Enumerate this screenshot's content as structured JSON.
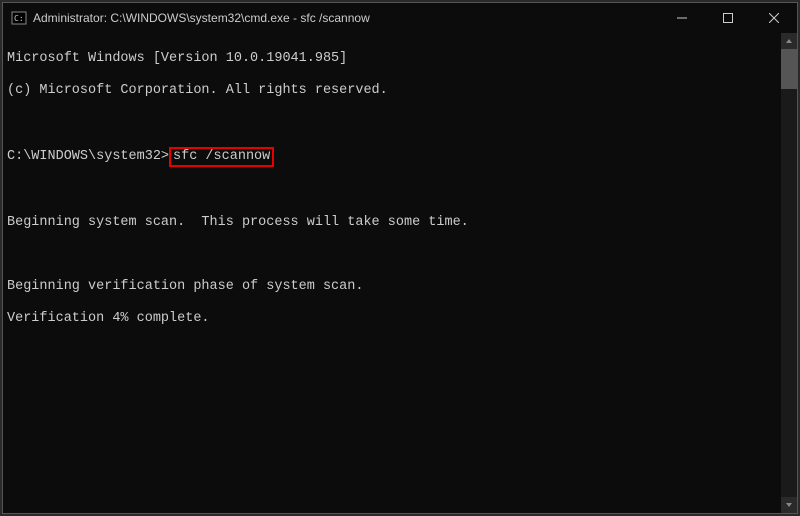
{
  "titlebar": {
    "title": "Administrator: C:\\WINDOWS\\system32\\cmd.exe - sfc  /scannow"
  },
  "terminal": {
    "line1": "Microsoft Windows [Version 10.0.19041.985]",
    "line2": "(c) Microsoft Corporation. All rights reserved.",
    "blank1": "",
    "prompt": "C:\\WINDOWS\\system32>",
    "command": "sfc /scannow",
    "blank2": "",
    "line3": "Beginning system scan.  This process will take some time.",
    "blank3": "",
    "line4": "Beginning verification phase of system scan.",
    "line5": "Verification 4% complete."
  }
}
